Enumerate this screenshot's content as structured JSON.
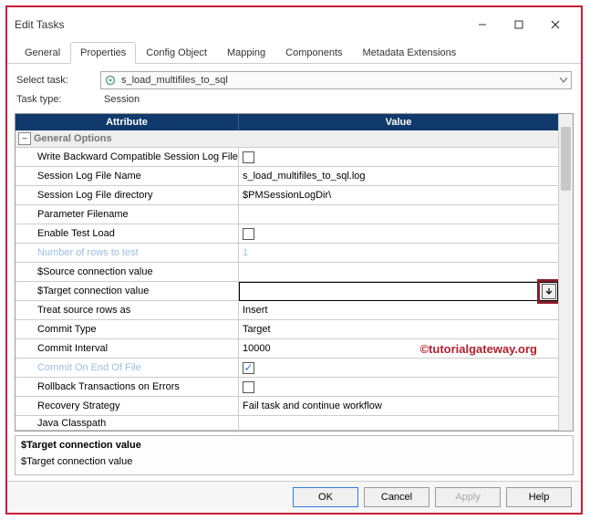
{
  "window": {
    "title": "Edit Tasks"
  },
  "tabs": {
    "general": "General",
    "properties": "Properties",
    "config_object": "Config Object",
    "mapping": "Mapping",
    "components": "Components",
    "metadata_extensions": "Metadata Extensions"
  },
  "form": {
    "select_task_label": "Select task:",
    "select_task_value": "s_load_multifiles_to_sql",
    "task_type_label": "Task type:",
    "task_type_value": "Session"
  },
  "grid": {
    "headers": {
      "attribute": "Attribute",
      "value": "Value"
    },
    "section": "General Options",
    "rows": {
      "write_backward": "Write Backward Compatible Session Log File",
      "session_log_name": "Session Log File Name",
      "session_log_name_val": "s_load_multifiles_to_sql.log",
      "session_log_dir": "Session Log File directory",
      "session_log_dir_val": "$PMSessionLogDir\\",
      "parameter_filename": "Parameter Filename",
      "enable_test_load": "Enable Test Load",
      "num_rows_test": "Number of rows to test",
      "num_rows_test_val": "1",
      "source_conn": "$Source connection value",
      "target_conn": "$Target connection value",
      "treat_source": "Treat source rows as",
      "treat_source_val": "Insert",
      "commit_type": "Commit Type",
      "commit_type_val": "Target",
      "commit_interval": "Commit Interval",
      "commit_interval_val": "10000",
      "commit_eof": "Commit On End Of File",
      "rollback": "Rollback Transactions on Errors",
      "recovery": "Recovery Strategy",
      "recovery_val": "Fail task and continue workflow",
      "java_classpath": "Java Classpath"
    }
  },
  "detail": {
    "title": "$Target connection value",
    "value": "$Target connection value"
  },
  "footer": {
    "ok": "OK",
    "cancel": "Cancel",
    "apply": "Apply",
    "help": "Help"
  },
  "watermark": "©tutorialgateway.org"
}
